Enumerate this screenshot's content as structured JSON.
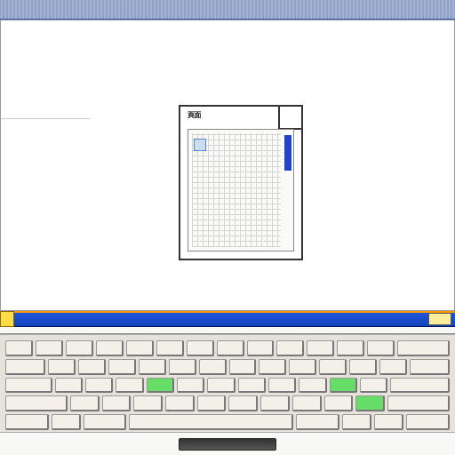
{
  "document": {
    "header_label": "頁面"
  },
  "colors": {
    "titlebar": "#2255dd",
    "accent": "#ff9900",
    "key_highlight": "#66dd66"
  }
}
